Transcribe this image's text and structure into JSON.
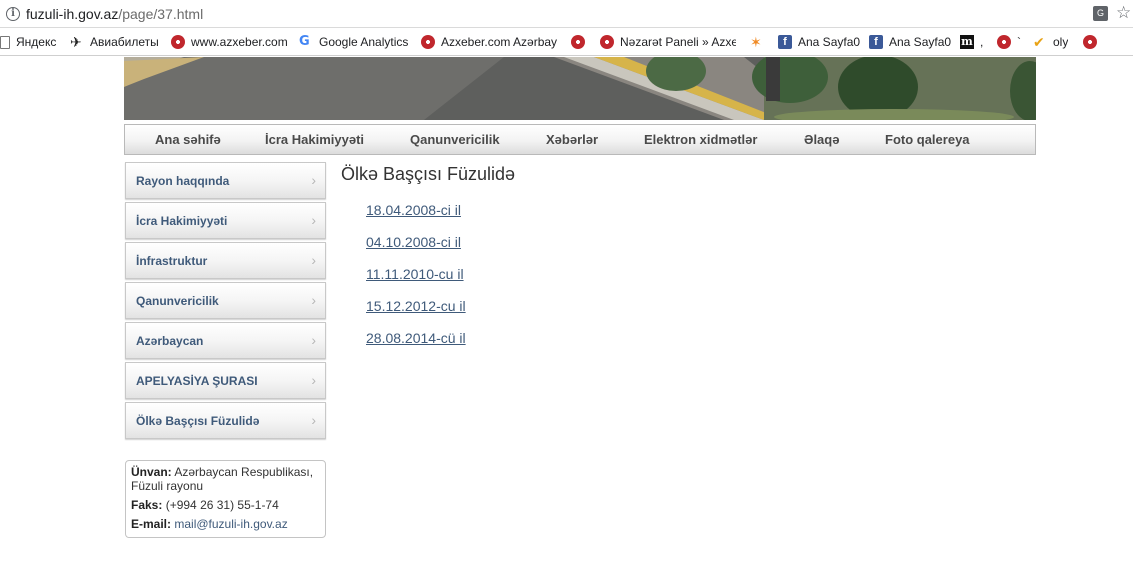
{
  "browser": {
    "url_host": "fuzuli-ih.gov.az",
    "url_path": "/page/37.html"
  },
  "bookmarks": [
    {
      "label": "Яндекс",
      "icon": "page-icon"
    },
    {
      "label": "Авиабилеты",
      "icon": "plane-icon"
    },
    {
      "label": "www.azxeber.com",
      "icon": "azxeber-icon"
    },
    {
      "label": "Google Analytics",
      "icon": "google-icon"
    },
    {
      "label": "Azxeber.com Azərbay",
      "icon": "azxeber-icon"
    },
    {
      "label": "",
      "icon": "azxeber-icon"
    },
    {
      "label": "Nəzarət Paneli » Azxe",
      "icon": "azxeber-icon"
    },
    {
      "label": "",
      "icon": "orange-icon"
    },
    {
      "label": "Ana Sayfa0",
      "icon": "facebook-icon"
    },
    {
      "label": "Ana Sayfa0",
      "icon": "facebook-icon"
    },
    {
      "label": ",",
      "icon": "m-icon"
    },
    {
      "label": "`",
      "icon": "azxeber-icon"
    },
    {
      "label": "oly",
      "icon": "check-icon"
    },
    {
      "label": "",
      "icon": "azxeber-icon"
    }
  ],
  "nav": [
    "Ana səhifə",
    "İcra Hakimiyyəti",
    "Qanunvericilik",
    "Xəbərlər",
    "Elektron xidmətlər",
    "Əlaqə",
    "Foto qalereya"
  ],
  "sidebar": [
    "Rayon haqqında",
    "İcra Hakimiyyəti",
    "İnfrastruktur",
    "Qanunvericilik",
    "Azərbaycan",
    "APELYASİYA ŞURASI",
    "Ölkə Başçısı Füzulidə"
  ],
  "contact": {
    "address_label": "Ünvan:",
    "address_value": "Azərbaycan Respublikası, Füzuli rayonu",
    "fax_label": "Faks:",
    "fax_value": "(+994 26 31) 55-1-74",
    "email_label": "E-mail:",
    "email_value": "mail@fuzuli-ih.gov.az"
  },
  "content": {
    "title": "Ölkə Başçısı Füzulidə",
    "links": [
      "18.04.2008-ci il",
      "04.10.2008-ci il",
      "11.11.2010-cu il",
      "15.12.2012-cu il",
      "28.08.2014-cü il"
    ]
  }
}
